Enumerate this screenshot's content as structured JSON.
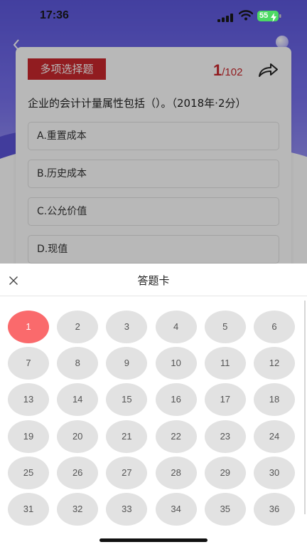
{
  "status_bar": {
    "time": "17:36",
    "battery": "55"
  },
  "question": {
    "type_label": "多项选择题",
    "current": "1",
    "total": "/102",
    "text": "企业的会计计量属性包括（）。（2018年·2分）",
    "options": [
      {
        "label": "A.重置成本"
      },
      {
        "label": "B.历史成本"
      },
      {
        "label": "C.公允价值"
      },
      {
        "label": "D.现值"
      }
    ]
  },
  "answer_sheet": {
    "title": "答题卡",
    "active_number": "1",
    "numbers": [
      "1",
      "2",
      "3",
      "4",
      "5",
      "6",
      "7",
      "8",
      "9",
      "10",
      "11",
      "12",
      "13",
      "14",
      "15",
      "16",
      "17",
      "18",
      "19",
      "20",
      "21",
      "22",
      "23",
      "24",
      "25",
      "26",
      "27",
      "28",
      "29",
      "30",
      "31",
      "32",
      "33",
      "34",
      "35",
      "36"
    ]
  },
  "colors": {
    "accent": "#c9282d",
    "active_cell": "#fa6a6c",
    "cell": "#e2e2e2",
    "banner": "#5d58dd"
  }
}
